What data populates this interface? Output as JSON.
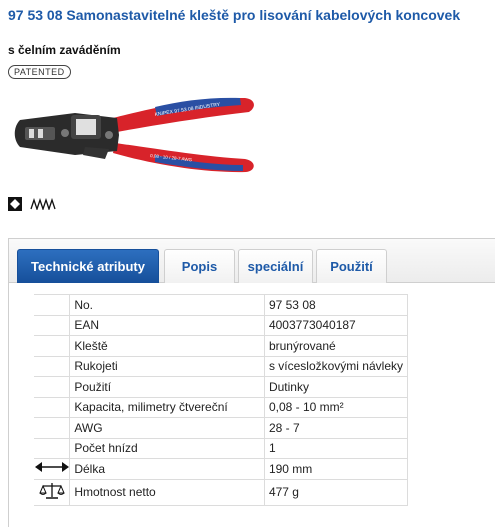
{
  "product": {
    "title": "97 53 08 Samonastavitelné kleště pro lisování kabelových koncovek",
    "subtitle": "s čelním zaváděním",
    "badge": "PATENTED",
    "image_text": {
      "upper_handle": "KNIPEX 97 53 08 INDUSTRY",
      "lower_handle": "0,08 - 10 / 28-7 AWG"
    },
    "colors": {
      "title": "#1e5aa8",
      "handle_red": "#d8232a",
      "handle_blue": "#2a4fa3",
      "head": "#2b2b2b"
    },
    "feature_icons": [
      "black-square-diamond-icon",
      "serrated-jaw-icon"
    ]
  },
  "tabs": [
    {
      "label": "Technické atributy",
      "active": true
    },
    {
      "label": "Popis",
      "active": false
    },
    {
      "label": "speciální",
      "active": false
    },
    {
      "label": "Použití",
      "active": false
    }
  ],
  "attributes": [
    {
      "name": "No.",
      "value": "97 53 08",
      "icon": ""
    },
    {
      "name": "EAN",
      "value": "4003773040187",
      "icon": ""
    },
    {
      "name": "Kleště",
      "value": "brunýrované",
      "icon": ""
    },
    {
      "name": "Rukojeti",
      "value": "s vícesložkovými návleky",
      "icon": ""
    },
    {
      "name": "Použití",
      "value": "Dutinky",
      "icon": ""
    },
    {
      "name": "Kapacita, milimetry čtvereční",
      "value": "0,08 - 10 mm²",
      "icon": ""
    },
    {
      "name": "AWG",
      "value": "28 - 7",
      "icon": ""
    },
    {
      "name": "Počet hnízd",
      "value": "1",
      "icon": ""
    },
    {
      "name": "Délka",
      "value": "190 mm",
      "icon": "length-arrow-icon"
    },
    {
      "name": "Hmotnost netto",
      "value": "477 g",
      "icon": "scale-icon"
    }
  ]
}
